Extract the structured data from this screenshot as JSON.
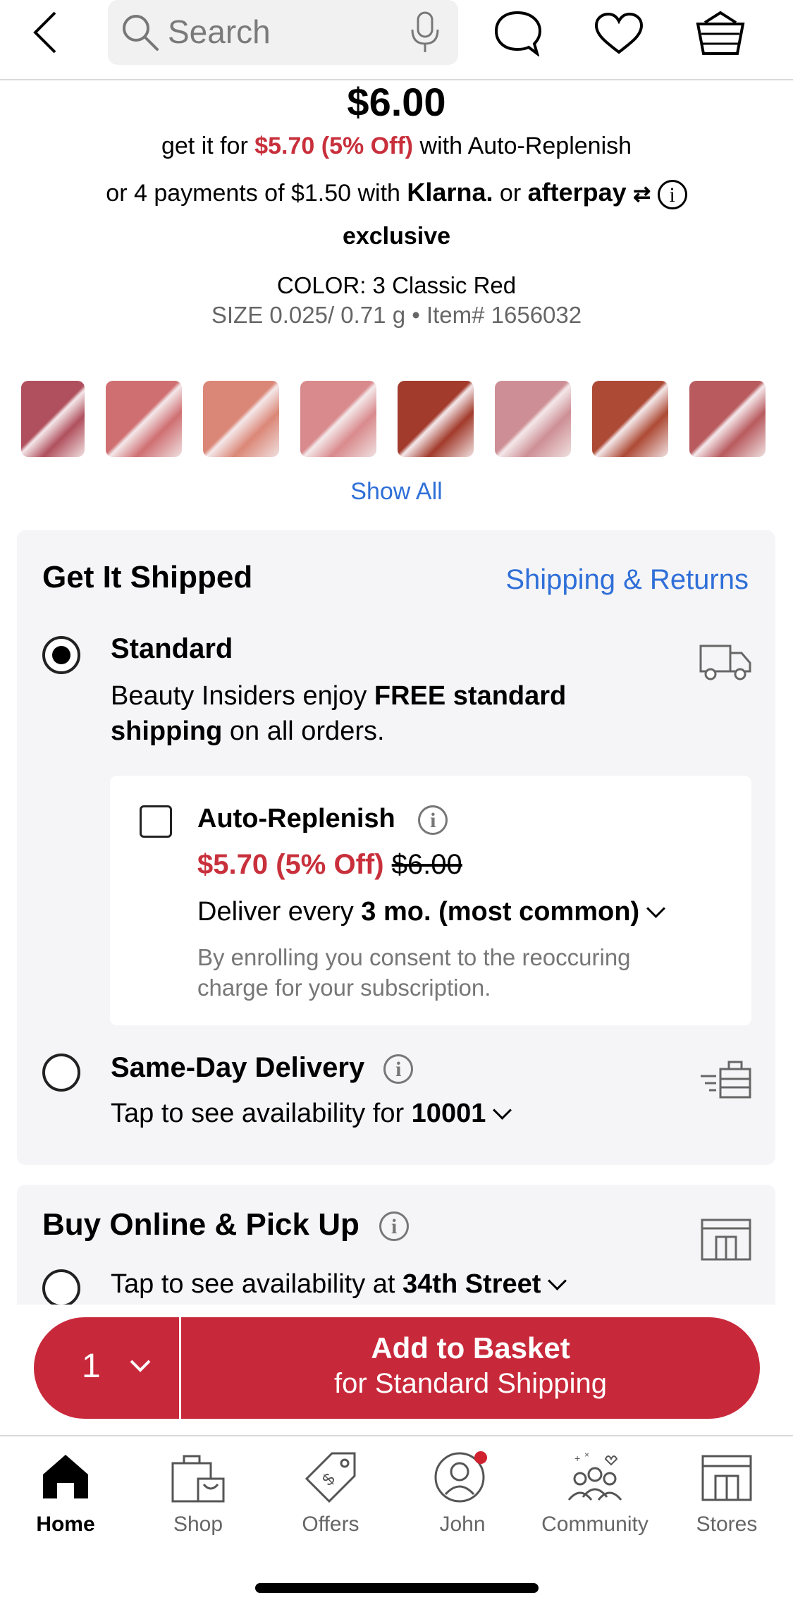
{
  "header": {
    "search_placeholder": "Search"
  },
  "product": {
    "price": "$6.00",
    "autoreplenish_prefix": "get it for",
    "autoreplenish_price": "$5.70 (5% Off)",
    "autoreplenish_suffix": "with Auto-Replenish",
    "payments_prefix": "or 4 payments of $1.50 with",
    "klarna": "Klarna.",
    "or": "or",
    "afterpay": "afterpay",
    "exclusive": "exclusive",
    "color_line": "COLOR: 3 Classic Red",
    "size_line": "SIZE 0.025/ 0.71 g • Item# 1656032",
    "show_all": "Show All",
    "swatch_colors": [
      "#b0505e",
      "#cf6f72",
      "#db8777",
      "#d98a8c",
      "#a23b2c",
      "#cd8f95",
      "#ad4a35",
      "#b85a5e"
    ]
  },
  "shipping": {
    "title": "Get It Shipped",
    "link": "Shipping & Returns",
    "standard": {
      "title": "Standard",
      "desc_1": "Beauty Insiders enjoy ",
      "desc_bold_1": "FREE standard",
      "desc_bold_2": "shipping",
      "desc_2": " on all orders."
    },
    "auto_replenish": {
      "title": "Auto-Replenish",
      "sale_price": "$5.70 (5% Off)",
      "old_price": "$6.00",
      "deliver_prefix": "Deliver every ",
      "deliver_value": "3 mo. (most common)",
      "consent_1": "By enrolling you consent to the reoccuring",
      "consent_2": "charge for your subscription."
    },
    "same_day": {
      "title": "Same-Day Delivery",
      "desc_prefix": "Tap to see availability for ",
      "zip": "10001"
    }
  },
  "pickup": {
    "title": "Buy Online & Pick Up",
    "desc_prefix": "Tap to see availability at ",
    "store": "34th Street"
  },
  "cta": {
    "quantity": "1",
    "label_1": "Add to Basket",
    "label_2": "for Standard Shipping"
  },
  "tabs": [
    {
      "label": "Home",
      "icon": "home-icon"
    },
    {
      "label": "Shop",
      "icon": "shop-bag-icon"
    },
    {
      "label": "Offers",
      "icon": "offers-tag-icon"
    },
    {
      "label": "John",
      "icon": "profile-icon"
    },
    {
      "label": "Community",
      "icon": "community-icon"
    },
    {
      "label": "Stores",
      "icon": "store-icon"
    }
  ],
  "colors": {
    "accent_red": "#c8293a",
    "link_blue": "#2f6fd8"
  }
}
